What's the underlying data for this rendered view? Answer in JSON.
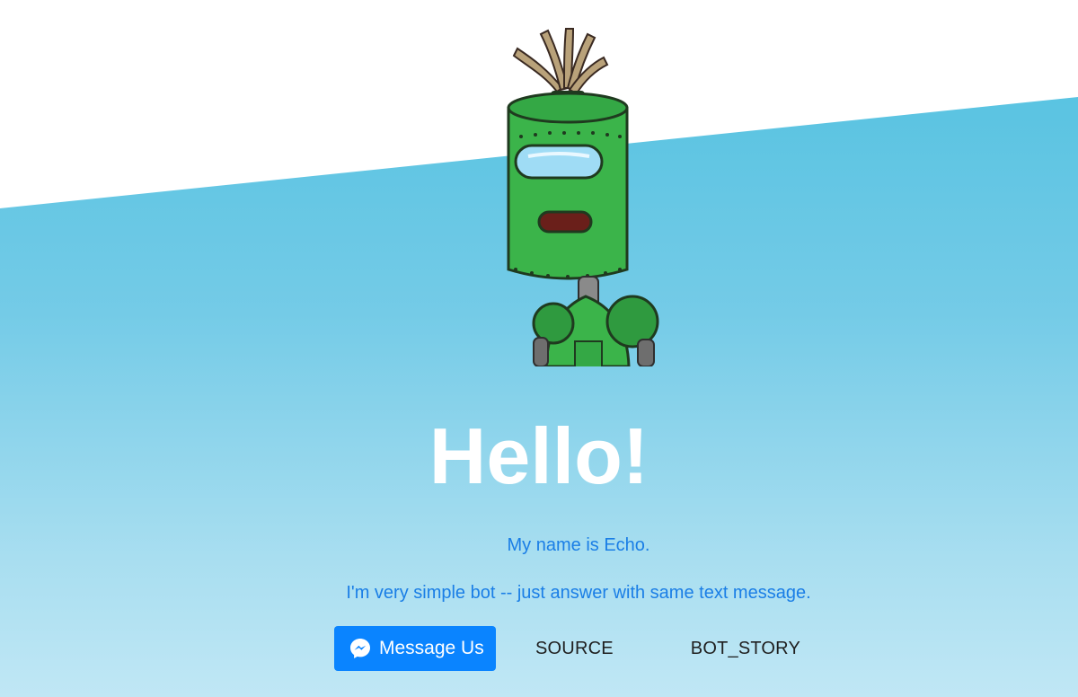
{
  "hero": {
    "title": "Hello!",
    "line1": "My name is Echo.",
    "line2": "I'm very simple bot -- just answer with same text message."
  },
  "actions": {
    "message_label": "Message Us",
    "source_label": "SOURCE",
    "story_label": "BOT_STORY"
  },
  "colors": {
    "primary": "#0a84ff",
    "text_blue": "#1a7ee6",
    "robot_green": "#3bb44a"
  },
  "icons": {
    "messenger": "messenger-icon",
    "robot": "robot-illustration"
  }
}
